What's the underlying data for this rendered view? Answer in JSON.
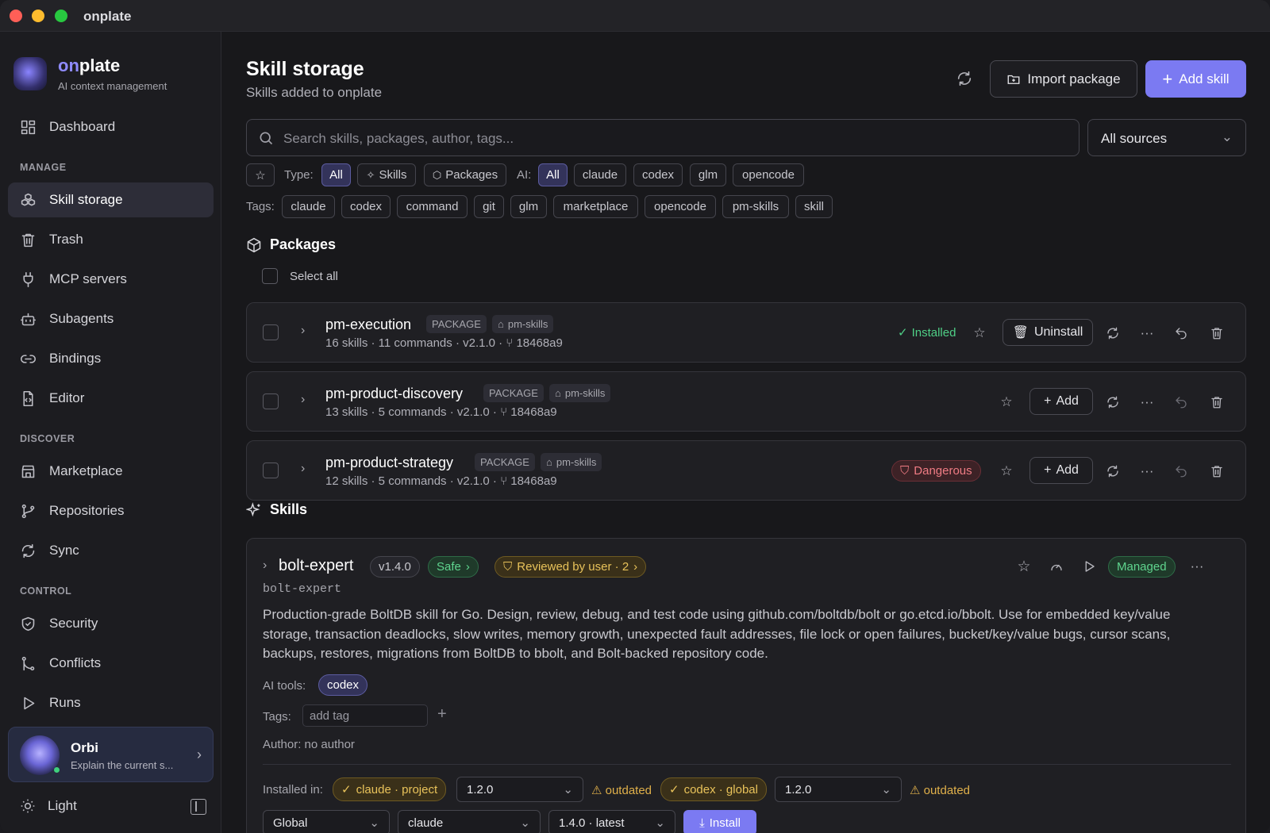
{
  "window": {
    "title": "onplate"
  },
  "brand": {
    "on": "on",
    "plate": "plate",
    "subtitle": "AI context management"
  },
  "nav": {
    "dashboard": "Dashboard",
    "manage": "MANAGE",
    "skill_storage": "Skill storage",
    "trash": "Trash",
    "mcp": "MCP servers",
    "subagents": "Subagents",
    "bindings": "Bindings",
    "editor": "Editor",
    "discover": "DISCOVER",
    "marketplace": "Marketplace",
    "repositories": "Repositories",
    "sync": "Sync",
    "control": "CONTROL",
    "security": "Security",
    "conflicts": "Conflicts",
    "runs": "Runs"
  },
  "orbi": {
    "name": "Orbi",
    "subtitle": "Explain the current s..."
  },
  "theme": {
    "label": "Light"
  },
  "page": {
    "title": "Skill storage",
    "subtitle": "Skills added to onplate",
    "import": "Import package",
    "add": "Add skill"
  },
  "search": {
    "placeholder": "Search skills, packages, author, tags...",
    "source": "All sources"
  },
  "filters": {
    "type_label": "Type:",
    "type_all": "All",
    "type_skills": "Skills",
    "type_packages": "Packages",
    "ai_label": "AI:",
    "ai_all": "All",
    "ai": [
      "claude",
      "codex",
      "glm",
      "opencode"
    ],
    "tags_label": "Tags:",
    "tags": [
      "claude",
      "codex",
      "command",
      "git",
      "glm",
      "marketplace",
      "opencode",
      "pm-skills",
      "skill"
    ]
  },
  "packages": {
    "heading": "Packages",
    "select_all": "Select all",
    "badge": "PACKAGE",
    "items": [
      {
        "name": "pm-execution",
        "source": "pm-skills",
        "meta": "16 skills · 11 commands  · v2.1.0  ·  ⑂ 18468a9",
        "status": "Installed",
        "action": "Uninstall"
      },
      {
        "name": "pm-product-discovery",
        "source": "pm-skills",
        "meta": "13 skills · 5 commands  · v2.1.0  ·  ⑂ 18468a9",
        "status": "",
        "action": "Add"
      },
      {
        "name": "pm-product-strategy",
        "source": "pm-skills",
        "meta": "12 skills · 5 commands  · v2.1.0  ·  ⑂ 18468a9",
        "status": "Dangerous",
        "action": "Add"
      }
    ]
  },
  "skills": {
    "heading": "Skills",
    "item": {
      "name": "bolt-expert",
      "version": "v1.4.0",
      "safe": "Safe",
      "reviewed": "Reviewed by user · 2",
      "managed": "Managed",
      "slug": "bolt-expert",
      "description": "Production-grade BoltDB skill for Go. Design, review, debug, and test code using github.com/boltdb/bolt or go.etcd.io/bbolt. Use for embedded key/value storage, transaction deadlocks, slow writes, memory growth, unexpected fault addresses, file lock or open failures, bucket/key/value bugs, cursor scans, backups, restores, migrations from BoltDB to bbolt, and Bolt-backed repository code.",
      "ai_tools_label": "AI tools:",
      "ai_tool": "codex",
      "tags_label": "Tags:",
      "tag_placeholder": "add tag",
      "author": "Author: no author",
      "installed_label": "Installed in:",
      "install1": "claude · project",
      "ver1": "1.2.0",
      "outdated": "outdated",
      "install2": "codex · global",
      "ver2": "1.2.0",
      "scope": "Global",
      "tool": "claude",
      "version_sel": "1.4.0 · latest",
      "install_btn": "Install"
    }
  }
}
